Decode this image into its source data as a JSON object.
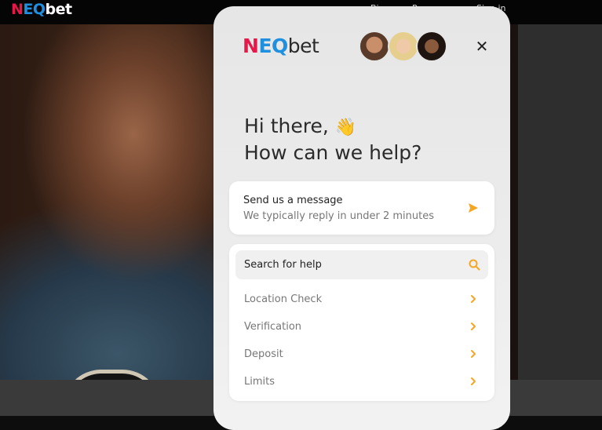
{
  "site": {
    "logo": {
      "n": "N",
      "e": "E",
      "q": "Q",
      "b": "bet"
    },
    "top_items": [
      "Bi",
      "P",
      "Sign in"
    ]
  },
  "widget": {
    "logo": {
      "n": "N",
      "e": "E",
      "q": "Q",
      "b": "bet"
    },
    "avatars": [
      "agent-avatar-1",
      "agent-avatar-2",
      "agent-avatar-3"
    ],
    "close_symbol": "✕",
    "greeting_line1": "Hi there,",
    "greeting_emoji": "👋",
    "greeting_line2": "How can we help?",
    "send_card": {
      "title": "Send us a message",
      "subtitle": "We typically reply in under 2 minutes",
      "icon": "send-arrow-icon"
    },
    "help": {
      "search_label": "Search for help",
      "search_icon": "search-icon",
      "items": [
        "Location Check",
        "Verification",
        "Deposit",
        "Limits"
      ]
    },
    "accent_color": "#f5a623"
  }
}
